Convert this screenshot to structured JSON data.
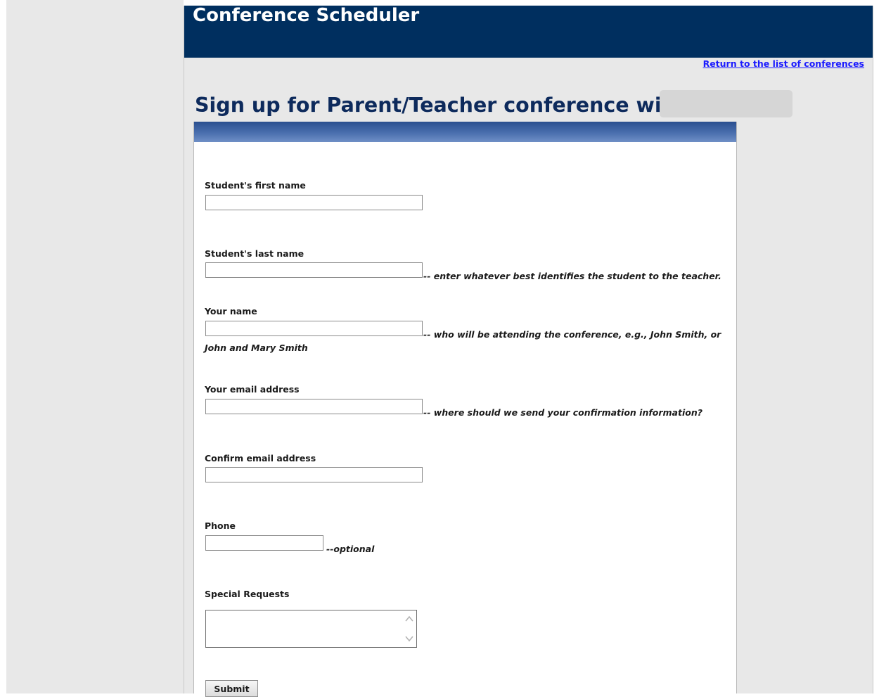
{
  "header": {
    "app_title": "Conference Scheduler",
    "return_link": "Return to the list of conferences"
  },
  "page": {
    "heading": "Sign up for Parent/Teacher conference with"
  },
  "form": {
    "fields": [
      {
        "label": "Student's first name",
        "value": "",
        "hint": ""
      },
      {
        "label": "Student's last name",
        "value": "",
        "hint": "-- enter whatever best identifies the student to the teacher."
      },
      {
        "label": "Your name",
        "value": "",
        "hint": "-- who will be attending the conference, e.g., John Smith, or",
        "hint_continued": "John and Mary Smith"
      },
      {
        "label": "Your email address",
        "value": "",
        "hint": "-- where should we send your confirmation information?"
      },
      {
        "label": "Confirm email address",
        "value": "",
        "hint": ""
      },
      {
        "label": "Phone",
        "value": "",
        "hint": "--optional"
      },
      {
        "label": "Special Requests",
        "value": ""
      }
    ],
    "submit_label": "Submit"
  },
  "icons": [
    "chevron-up-icon",
    "chevron-down-icon"
  ],
  "colors": {
    "banner": "#002f5f",
    "heading": "#0d2a5c",
    "link": "#1a1aff",
    "page_background": "#e8e8e8",
    "form_background": "#ffffff"
  }
}
